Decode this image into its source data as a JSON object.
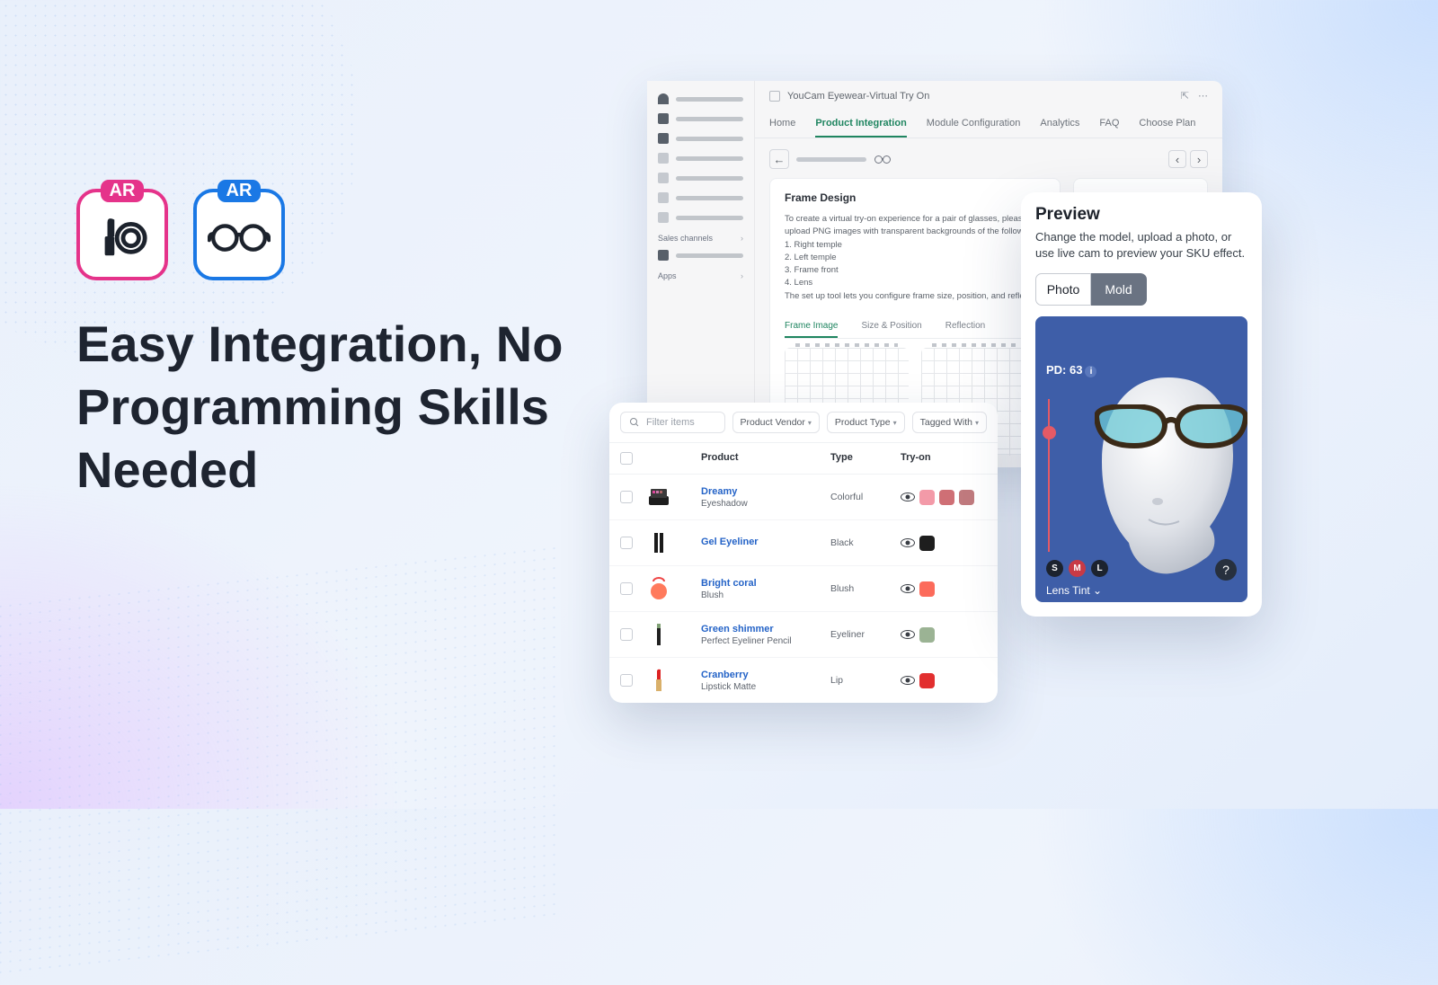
{
  "hero": {
    "ar_tag": "AR",
    "headline": "Easy Integration, No Programming Skills Needed"
  },
  "admin": {
    "title": "YouCam Eyewear-Virtual Try On",
    "sidebar": {
      "sales_channels": "Sales channels",
      "apps": "Apps"
    },
    "tabs": [
      "Home",
      "Product Integration",
      "Module Configuration",
      "Analytics",
      "FAQ",
      "Choose Plan"
    ],
    "active_tab": "Product Integration",
    "panel": {
      "title": "Frame Design",
      "intro": "To create a virtual try-on experience for a pair of glasses, please upload PNG images with transparent backgrounds of the following:",
      "list": [
        "1. Right temple",
        "2. Left temple",
        "3. Frame front",
        "4. Lens"
      ],
      "footnote": "The set up tool lets you configure frame size, position, and reflection.",
      "subtabs": [
        "Frame Image",
        "Size & Position",
        "Reflection"
      ]
    },
    "preview_label": "Preview"
  },
  "products": {
    "search_placeholder": "Filter items",
    "filters": [
      "Product Vendor",
      "Product Type",
      "Tagged With"
    ],
    "columns": {
      "product": "Product",
      "type": "Type",
      "tryon": "Try-on"
    },
    "rows": [
      {
        "name": "Dreamy",
        "sub": "Eyeshadow",
        "type": "Colorful",
        "swatches": [
          "#f39aa8",
          "#cf6f75",
          "#c07a7e"
        ]
      },
      {
        "name": "Gel Eyeliner",
        "sub": "",
        "type": "Black",
        "swatches": [
          "#1e1e1e"
        ]
      },
      {
        "name": "Bright coral",
        "sub": "Blush",
        "type": "Blush",
        "swatches": [
          "#fc6b5b"
        ]
      },
      {
        "name": "Green shimmer",
        "sub": "Perfect Eyeliner Pencil",
        "type": "Eyeliner",
        "swatches": [
          "#9bb394"
        ]
      },
      {
        "name": "Cranberry",
        "sub": "Lipstick Matte",
        "type": "Lip",
        "swatches": [
          "#e22f2f"
        ]
      }
    ]
  },
  "preview": {
    "title": "Preview",
    "desc": "Change the model, upload a photo, or use live cam to preview your SKU effect.",
    "toggle": {
      "photo": "Photo",
      "mold": "Mold"
    },
    "pd_label": "PD:",
    "pd_value": "63",
    "sizes": [
      "S",
      "M",
      "L"
    ],
    "size_active": "M",
    "lens_label": "Lens Tint",
    "help": "?"
  }
}
